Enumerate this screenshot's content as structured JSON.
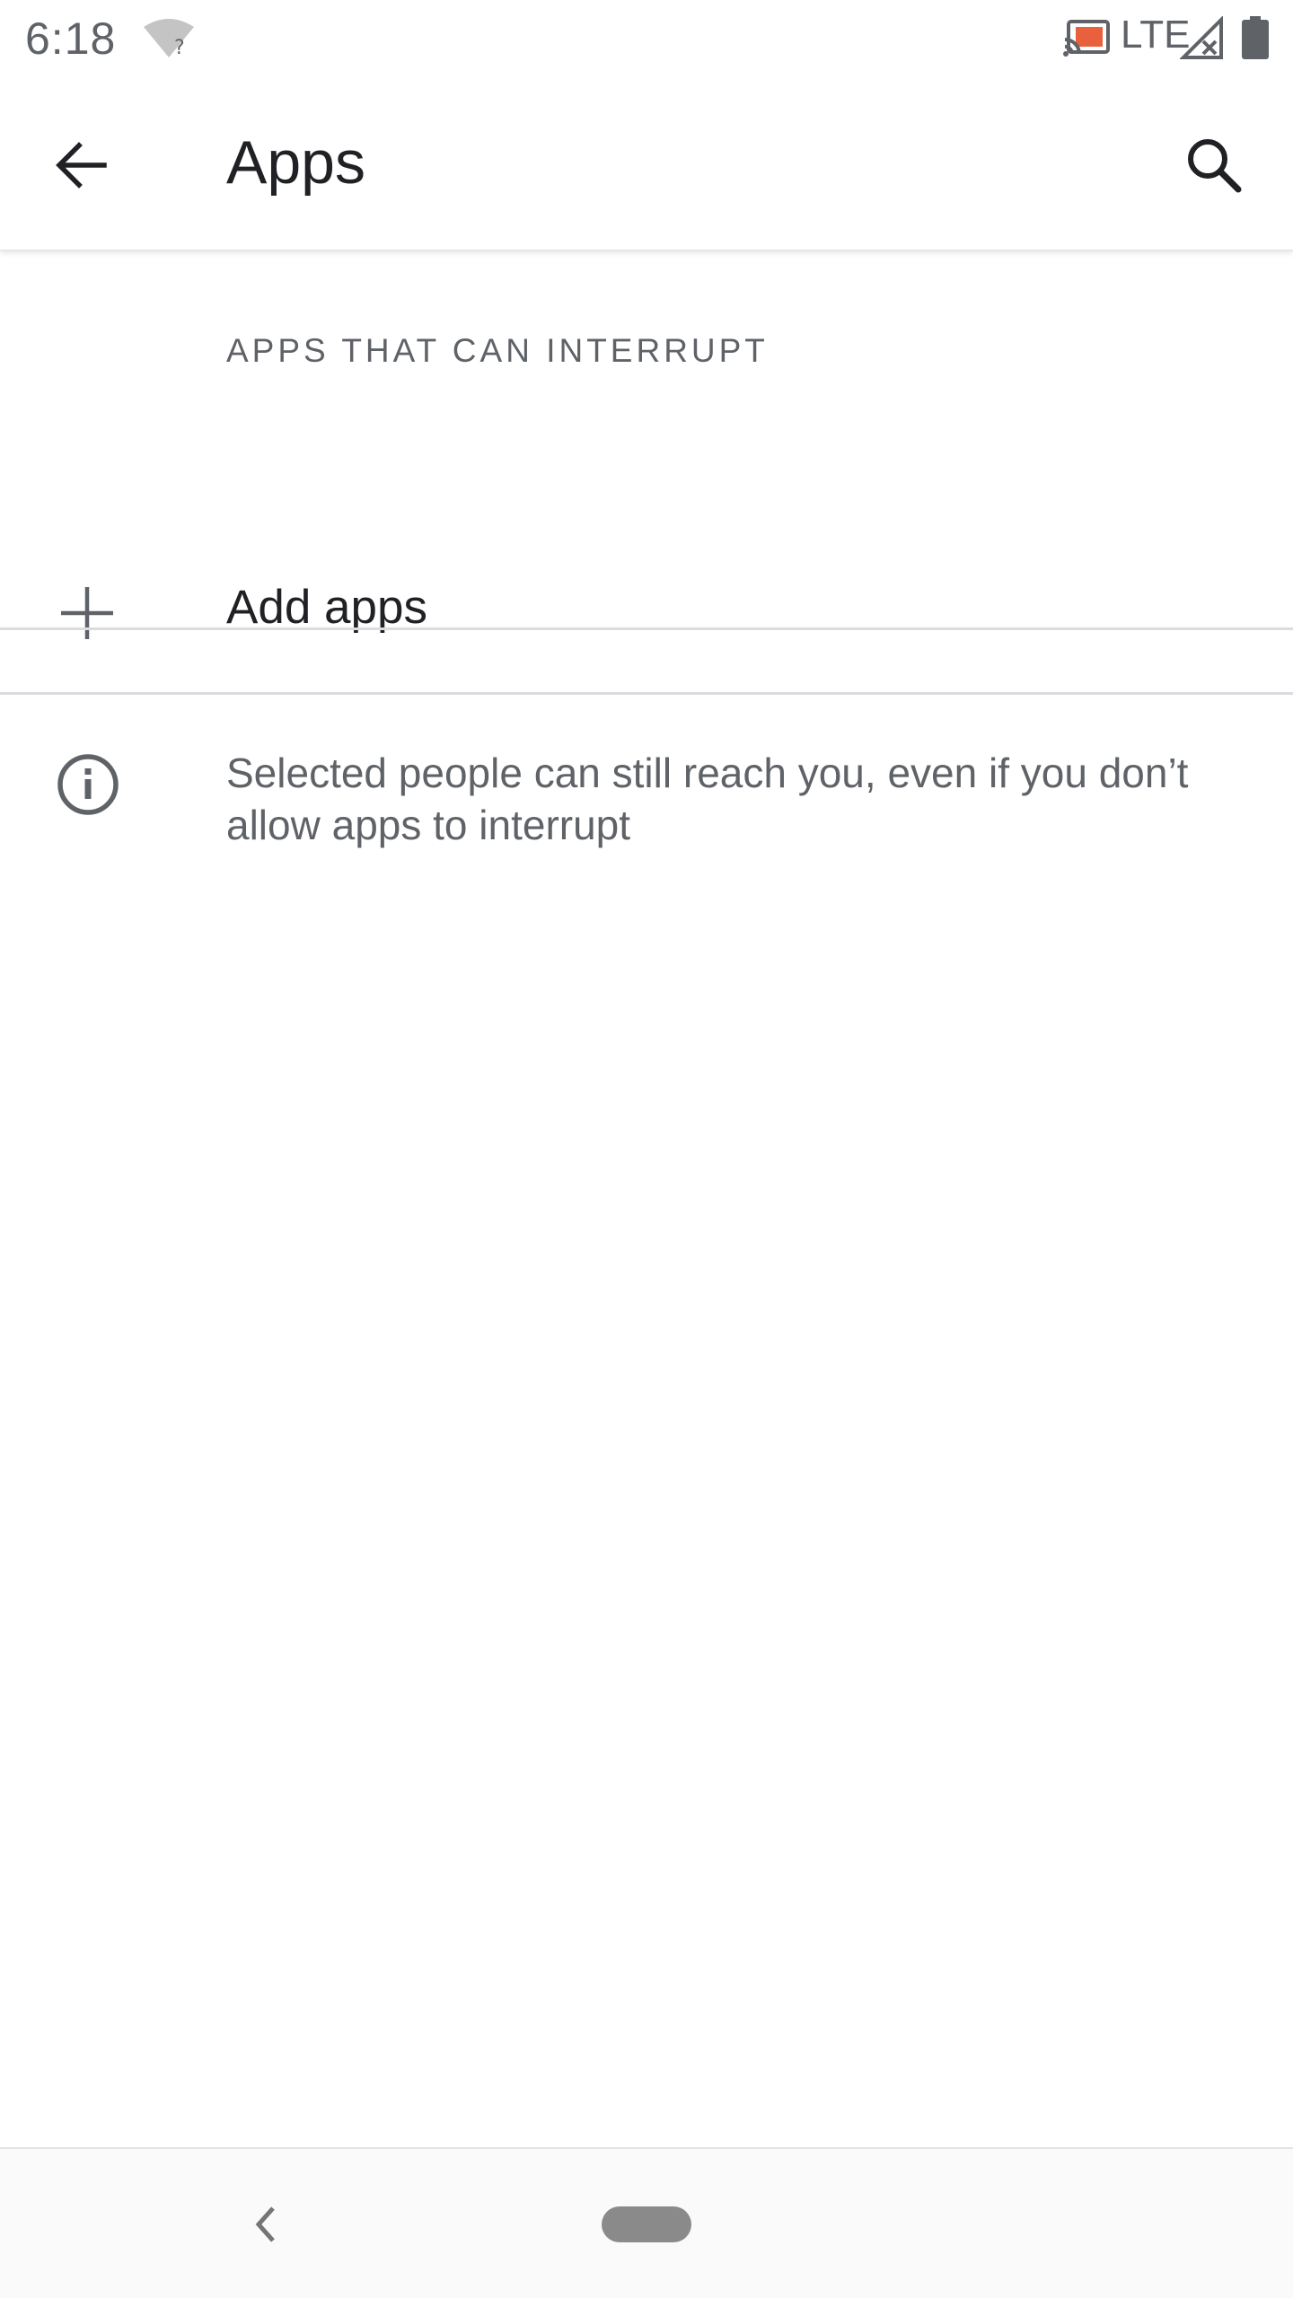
{
  "status_bar": {
    "time": "6:18",
    "network_label": "LTE",
    "icons": [
      "wifi-unknown-icon",
      "cast-icon",
      "signal-icon",
      "battery-icon"
    ],
    "cast_color": "#e8603c"
  },
  "app_bar": {
    "back_icon": "arrow-back-icon",
    "title": "Apps",
    "search_icon": "search-icon"
  },
  "content": {
    "section_header": "APPS THAT CAN INTERRUPT",
    "add_apps": {
      "icon": "plus-icon",
      "label": "Add apps"
    },
    "info": {
      "icon": "info-icon",
      "text": "Selected people can still reach you, even if you don’t allow apps to interrupt"
    }
  },
  "nav_bar": {
    "back_icon": "chevron-left-icon",
    "home_icon": "home-pill-icon"
  }
}
